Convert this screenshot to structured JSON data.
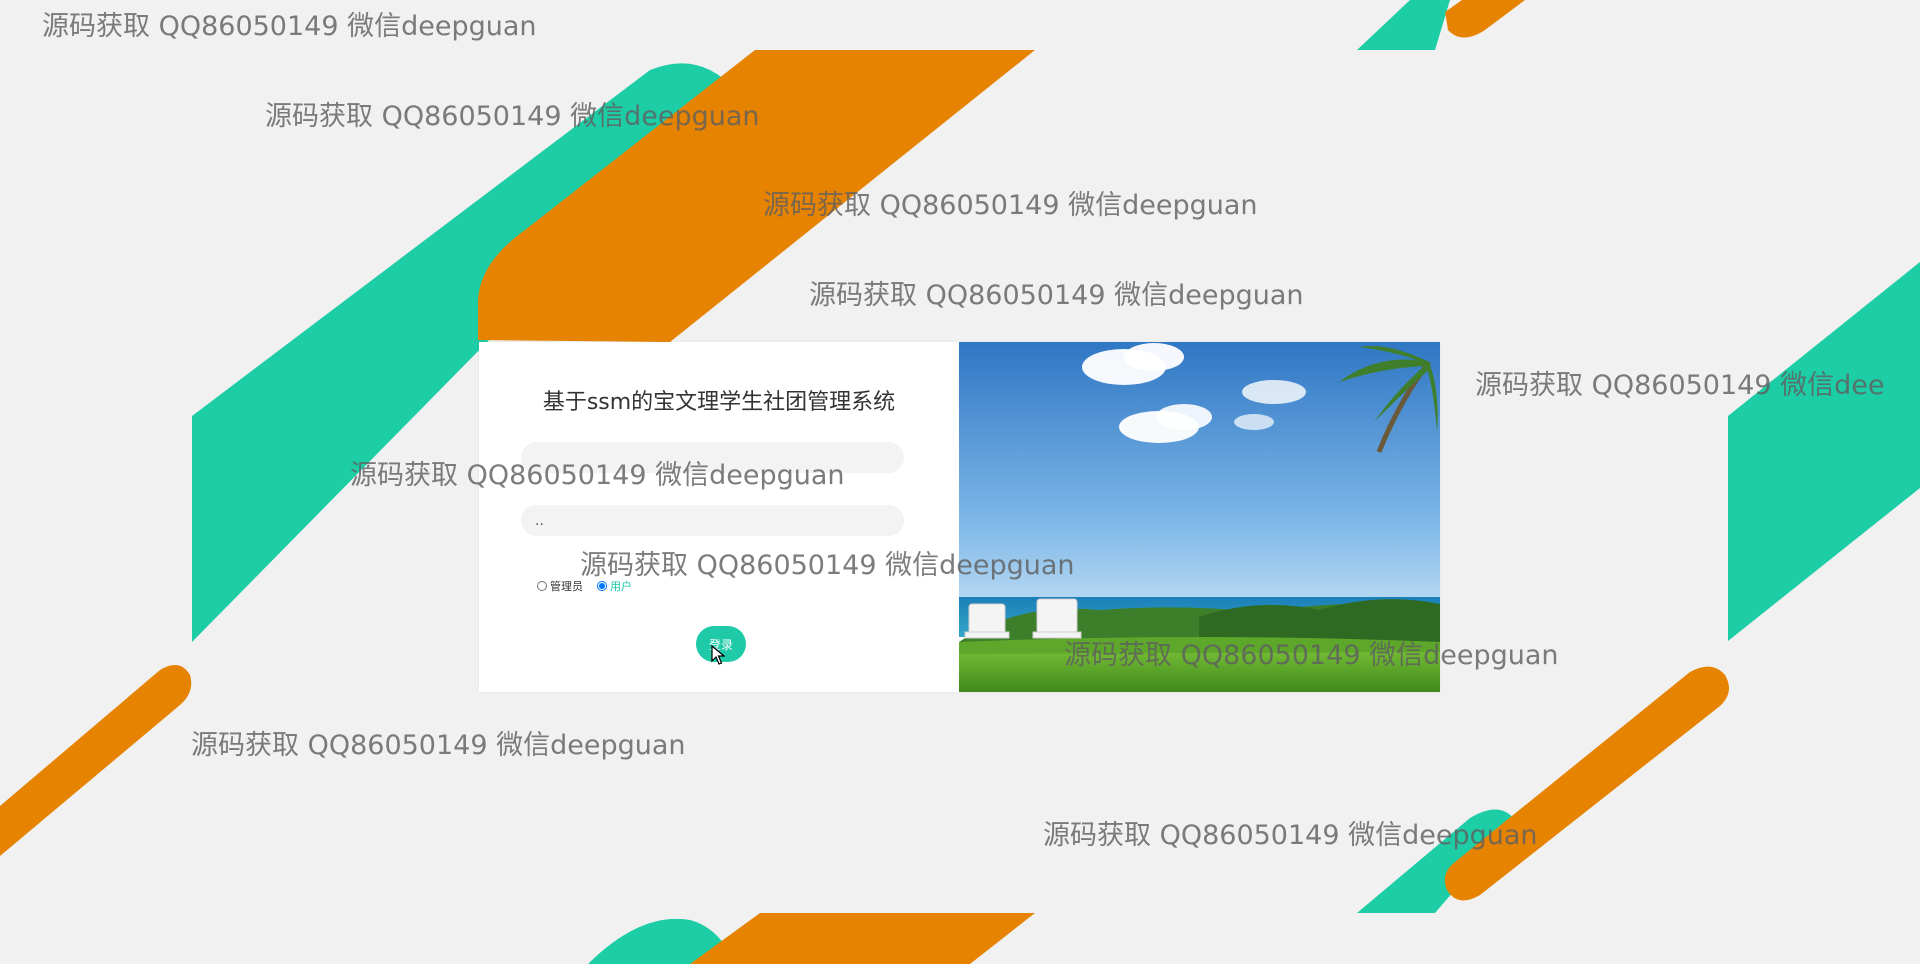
{
  "login": {
    "system_title": "基于ssm的宝文理学生社团管理系统",
    "username_value": "",
    "password_value": "..",
    "roles": [
      {
        "label": "管理员",
        "selected": false
      },
      {
        "label": "用户",
        "selected": true
      }
    ],
    "login_button": "登录"
  },
  "watermarks": [
    "源码获取 QQ86050149 微信deepguan",
    "源码获取 QQ86050149 微信deepguan",
    "源码获取 QQ86050149 微信deepguan",
    "源码获取 QQ86050149 微信deepguan",
    "源码获取 QQ86050149 微信dee",
    "源码获取 QQ86050149 微信deepguan",
    "源码获取 QQ86050149 微信deepguan",
    "源码获取 QQ86050149 微信deepguan",
    "源码获取 QQ86050149 微信deepguan",
    "源码获取 QQ86050149 微信deepguan"
  ],
  "colors": {
    "accent_teal": "#1ecaa7",
    "accent_orange": "#e68301",
    "page_background": "#f1f1f1"
  }
}
